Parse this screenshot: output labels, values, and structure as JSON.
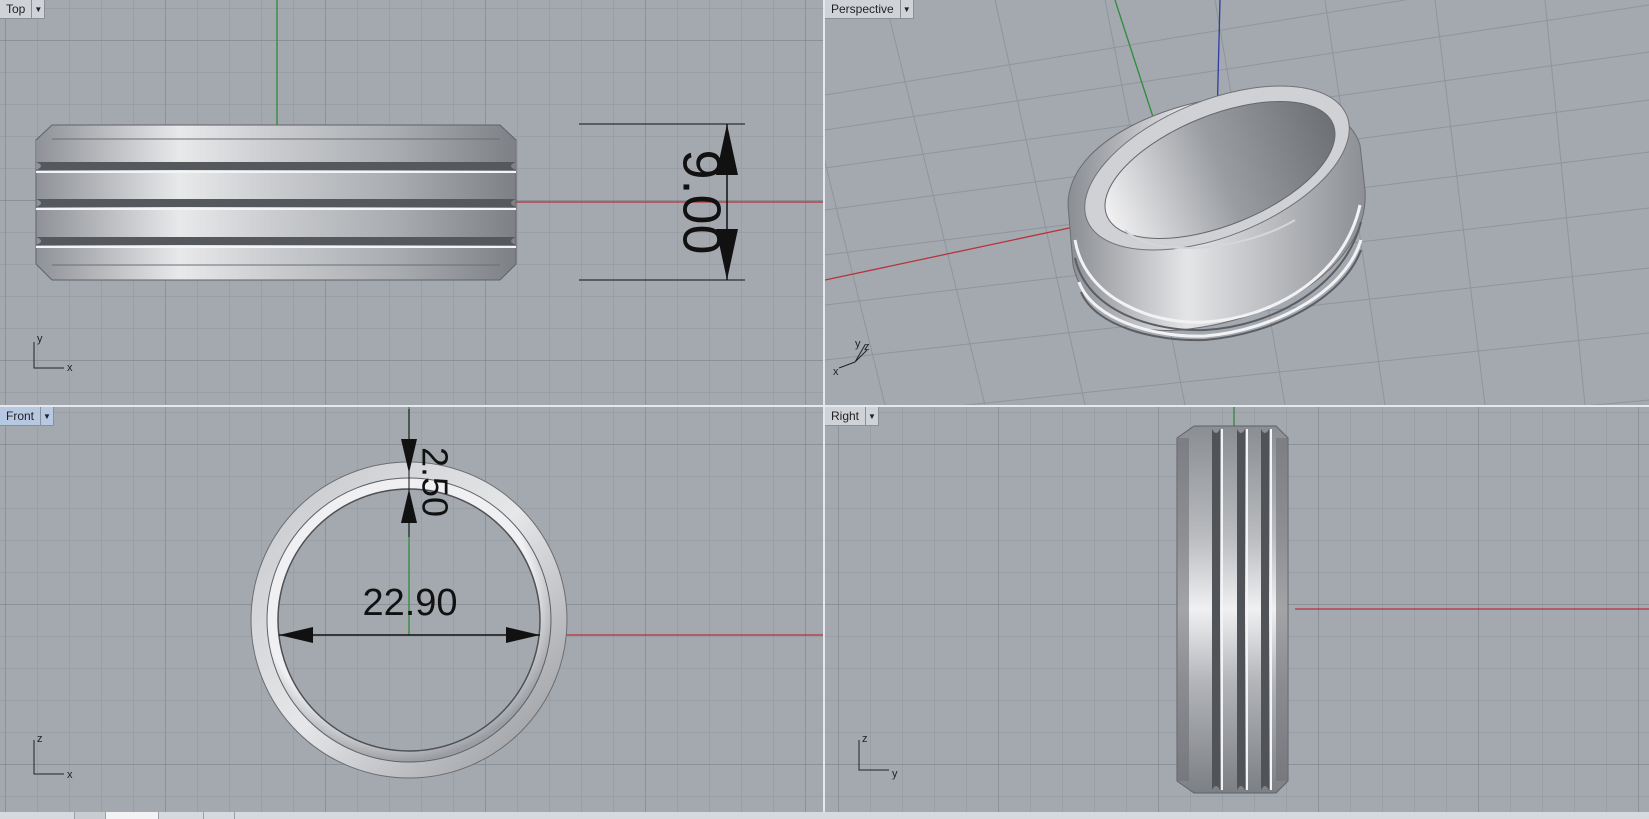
{
  "viewports": {
    "top": {
      "label": "Top"
    },
    "perspective": {
      "label": "Perspective"
    },
    "front": {
      "label": "Front"
    },
    "right": {
      "label": "Right"
    }
  },
  "dimensions": {
    "top_width": "9.00",
    "front_thickness": "2.50",
    "front_inner_diameter": "22.90"
  },
  "axis_labels": {
    "top": [
      "y",
      "x"
    ],
    "perspective": [
      "y",
      "z",
      "x"
    ],
    "front": [
      "z",
      "x"
    ],
    "right": [
      "z",
      "y"
    ]
  },
  "colors": {
    "x_axis": "#c0392b",
    "y_axis": "#2e8b3a",
    "z_axis": "#2c3e9e",
    "viewport_bg": "#a4a9b0",
    "active_tab": "#b7c9e2"
  },
  "icons": {
    "viewport_menu": "triangle-down"
  }
}
